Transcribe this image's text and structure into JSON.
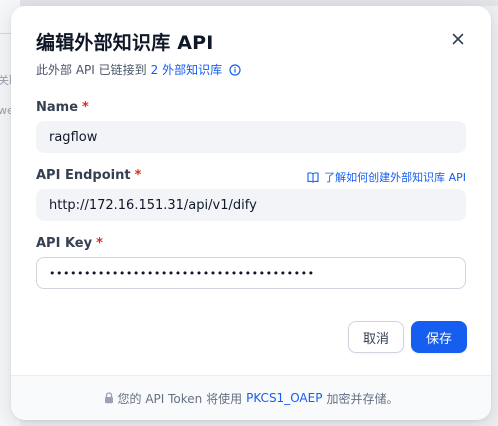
{
  "background": {
    "text_1": "关联",
    "text_2": "we"
  },
  "modal": {
    "title": "编辑外部知识库 API",
    "subtitle_prefix": "此外部 API 已链接到",
    "subtitle_link": "2 外部知识库",
    "close_icon": "close-icon",
    "info_icon": "info-icon"
  },
  "fields": {
    "name": {
      "label": "Name",
      "required_mark": "*",
      "value": "ragflow"
    },
    "endpoint": {
      "label": "API Endpoint",
      "required_mark": "*",
      "value": "http://172.16.151.31/api/v1/dify",
      "doc_link": "了解如何创建外部知识库 API",
      "doc_icon": "book-icon"
    },
    "api_key": {
      "label": "API Key",
      "required_mark": "*",
      "value": "••••••••••••••••••••••••••••••••••••••"
    }
  },
  "actions": {
    "cancel_label": "取消",
    "save_label": "保存"
  },
  "footer": {
    "lock_icon": "lock-icon",
    "text_before": "您的 API Token 将使用",
    "link": "PKCS1_OAEP",
    "text_after": "加密并存储。"
  },
  "colors": {
    "accent": "#155eef",
    "required": "#d92d20",
    "input_bg": "#f2f4f7"
  }
}
